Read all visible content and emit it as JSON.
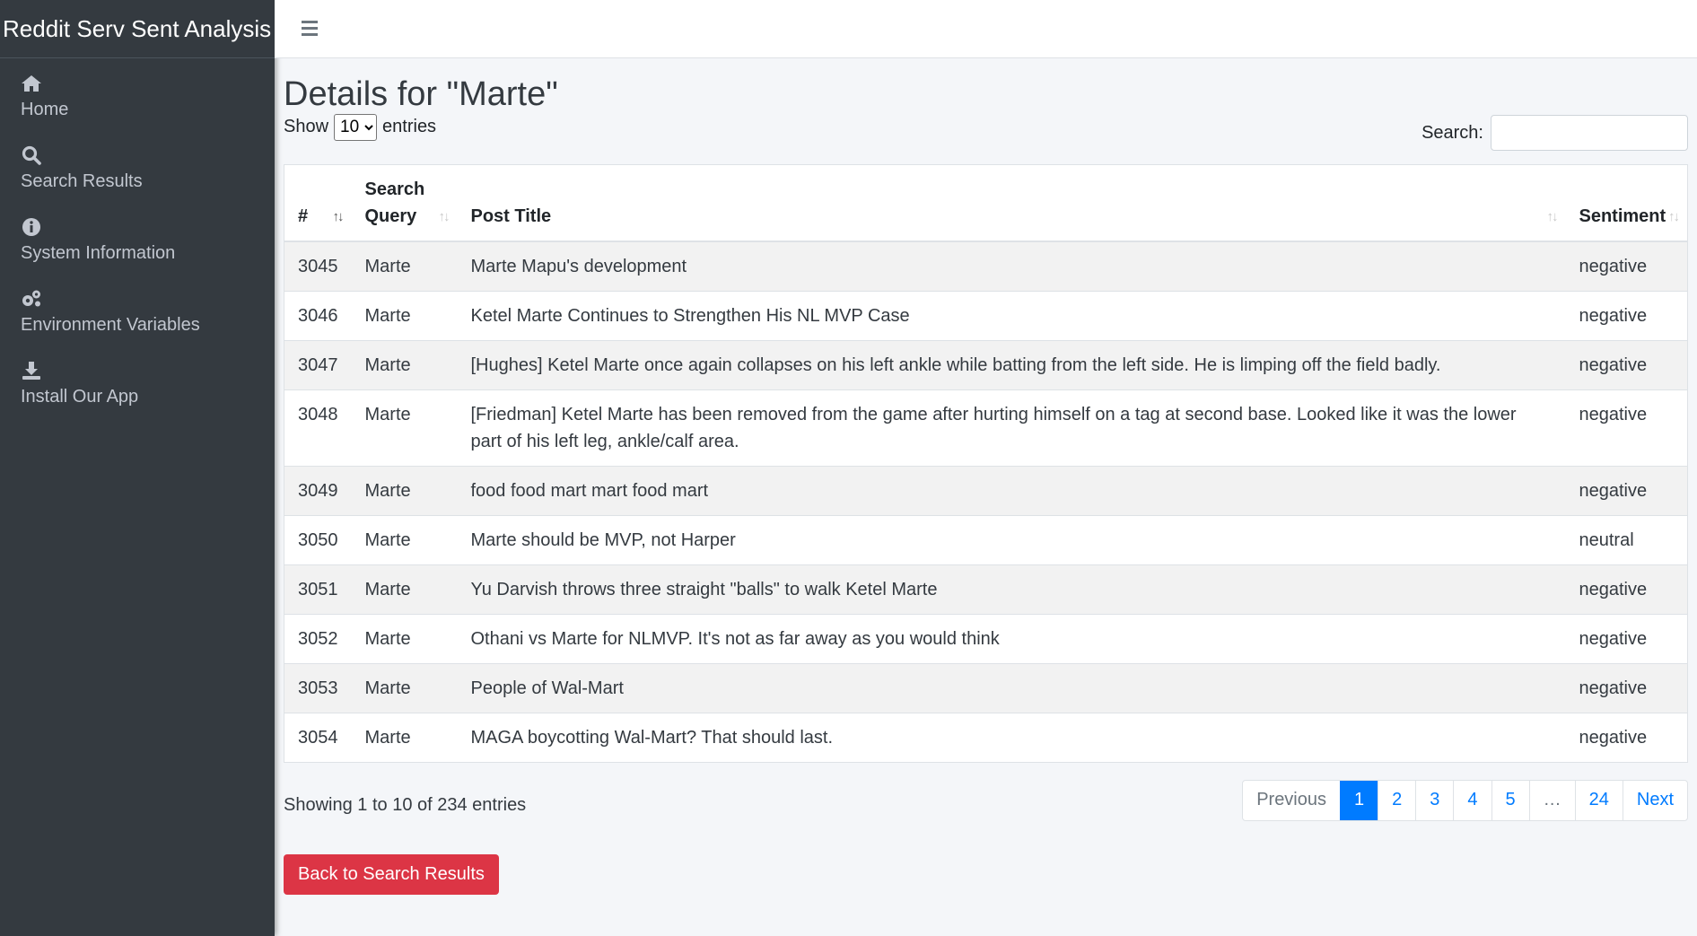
{
  "brand": "Reddit Serv Sent Analysis",
  "sidebar": {
    "items": [
      {
        "label": "Home",
        "icon": "home-icon"
      },
      {
        "label": "Search Results",
        "icon": "search-icon"
      },
      {
        "label": "System Information",
        "icon": "info-icon"
      },
      {
        "label": "Environment Variables",
        "icon": "gears-icon"
      },
      {
        "label": "Install Our App",
        "icon": "download-icon"
      }
    ]
  },
  "main": {
    "title": "Details for \"Marte\"",
    "length": {
      "show": "Show",
      "value": "10",
      "entries": "entries"
    },
    "search_label": "Search:",
    "columns": [
      "#",
      "Search Query",
      "Post Title",
      "Sentiment"
    ],
    "rows": [
      {
        "id": "3045",
        "query": "Marte",
        "title": "Marte Mapu's development",
        "sentiment": "negative"
      },
      {
        "id": "3046",
        "query": "Marte",
        "title": "Ketel Marte Continues to Strengthen His NL MVP Case",
        "sentiment": "negative"
      },
      {
        "id": "3047",
        "query": "Marte",
        "title": "[Hughes] Ketel Marte once again collapses on his left ankle while batting from the left side. He is limping off the field badly.",
        "sentiment": "negative"
      },
      {
        "id": "3048",
        "query": "Marte",
        "title": "[Friedman] Ketel Marte has been removed from the game after hurting himself on a tag at second base. Looked like it was the lower part of his left leg, ankle/calf area.",
        "sentiment": "negative"
      },
      {
        "id": "3049",
        "query": "Marte",
        "title": "food food mart mart food mart",
        "sentiment": "negative"
      },
      {
        "id": "3050",
        "query": "Marte",
        "title": "Marte should be MVP, not Harper",
        "sentiment": "neutral"
      },
      {
        "id": "3051",
        "query": "Marte",
        "title": "Yu Darvish throws three straight \"balls\" to walk Ketel Marte",
        "sentiment": "negative"
      },
      {
        "id": "3052",
        "query": "Marte",
        "title": "Othani vs Marte for NLMVP. It's not as far away as you would think",
        "sentiment": "negative"
      },
      {
        "id": "3053",
        "query": "Marte",
        "title": "People of Wal-Mart",
        "sentiment": "negative"
      },
      {
        "id": "3054",
        "query": "Marte",
        "title": "MAGA boycotting Wal-Mart? That should last.",
        "sentiment": "negative"
      }
    ],
    "info": "Showing 1 to 10 of 234 entries",
    "pagination": {
      "previous": "Previous",
      "pages": [
        "1",
        "2",
        "3",
        "4",
        "5",
        "…",
        "24"
      ],
      "next": "Next"
    },
    "back_button": "Back to Search Results"
  },
  "colors": {
    "sidebar": "#343a40",
    "primary": "#007bff",
    "danger": "#dc3545"
  }
}
